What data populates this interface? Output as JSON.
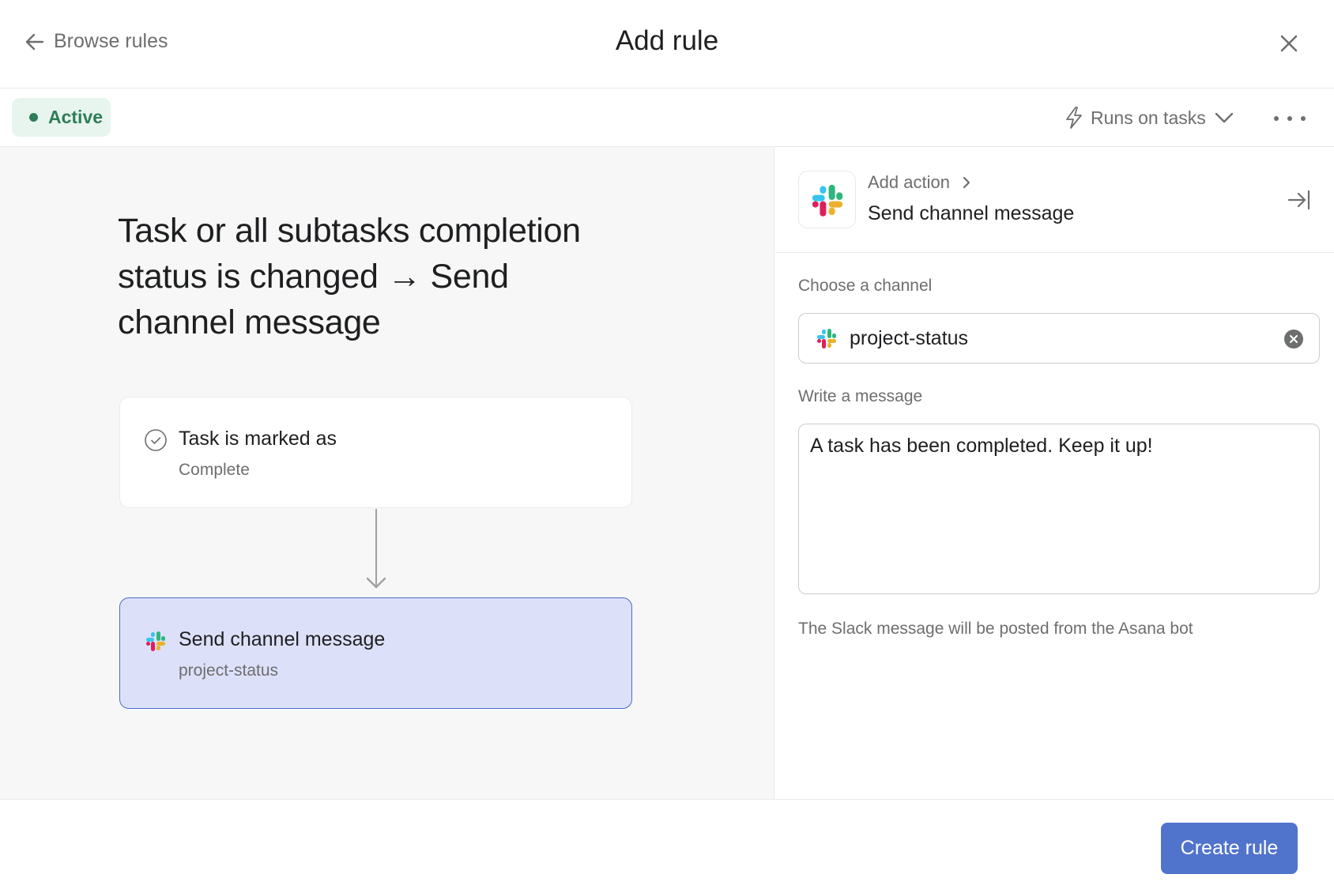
{
  "header": {
    "back_label": "Browse rules",
    "title": "Add rule"
  },
  "toolbar": {
    "status_label": "Active",
    "status_color": "#2e7d57",
    "runs_on_label": "Runs on tasks"
  },
  "canvas": {
    "rule_heading": "Task or all subtasks completion status is changed → Send channel message",
    "trigger": {
      "title": "Task is marked as",
      "subtitle": "Complete",
      "icon": "check-circle-icon"
    },
    "action": {
      "title": "Send channel message",
      "subtitle": "project-status",
      "icon": "slack-icon"
    }
  },
  "side_panel": {
    "breadcrumb": "Add action",
    "title": "Send channel message",
    "channel_label": "Choose a channel",
    "channel_value": "project-status",
    "message_label": "Write a message",
    "message_value": "A task has been completed. Keep it up!",
    "hint": "The Slack message will be posted from the Asana bot"
  },
  "footer": {
    "create_label": "Create rule",
    "accent_color": "#5073cc"
  }
}
